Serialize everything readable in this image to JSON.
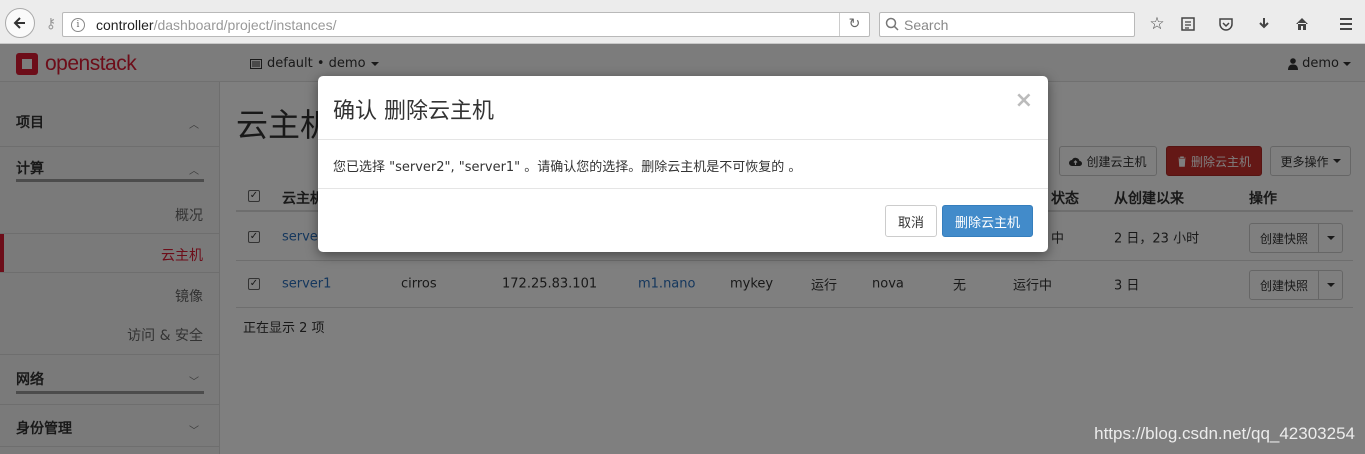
{
  "browser": {
    "url_host": "controller",
    "url_path": "/dashboard/project/instances/",
    "search_placeholder": "Search"
  },
  "topnav": {
    "logo_text": "openstack",
    "project_selector": "default • demo",
    "user": "demo"
  },
  "sidebar": {
    "project_label": "项目",
    "compute_label": "计算",
    "items": [
      {
        "label": "概况"
      },
      {
        "label": "云主机"
      },
      {
        "label": "镜像"
      },
      {
        "label": "访问 & 安全"
      }
    ],
    "network_label": "网络",
    "identity_label": "身份管理"
  },
  "main": {
    "title": "云主机",
    "buttons": {
      "create": "创建云主机",
      "delete": "删除云主机",
      "more": "更多操作"
    },
    "table": {
      "headers": [
        "云主机",
        "状态",
        "从创建以来",
        "操作"
      ],
      "rows": [
        {
          "name": "server",
          "status": "中",
          "age": "2 日，23 小时",
          "action": "创建快照"
        },
        {
          "name": "server1",
          "image": "cirros",
          "ip": "172.25.83.101",
          "flavor": "m1.nano",
          "keypair": "mykey",
          "state": "运行",
          "zone": "nova",
          "task": "无",
          "power": "运行中",
          "age": "3 日",
          "action": "创建快照"
        }
      ]
    },
    "showing": "正在显示 2 项"
  },
  "modal": {
    "title": "确认 删除云主机",
    "body": "您已选择 \"server2\", \"server1\" 。请确认您的选择。删除云主机是不可恢复的 。",
    "cancel": "取消",
    "confirm": "删除云主机"
  },
  "watermark": "https://blog.csdn.net/qq_42303254"
}
